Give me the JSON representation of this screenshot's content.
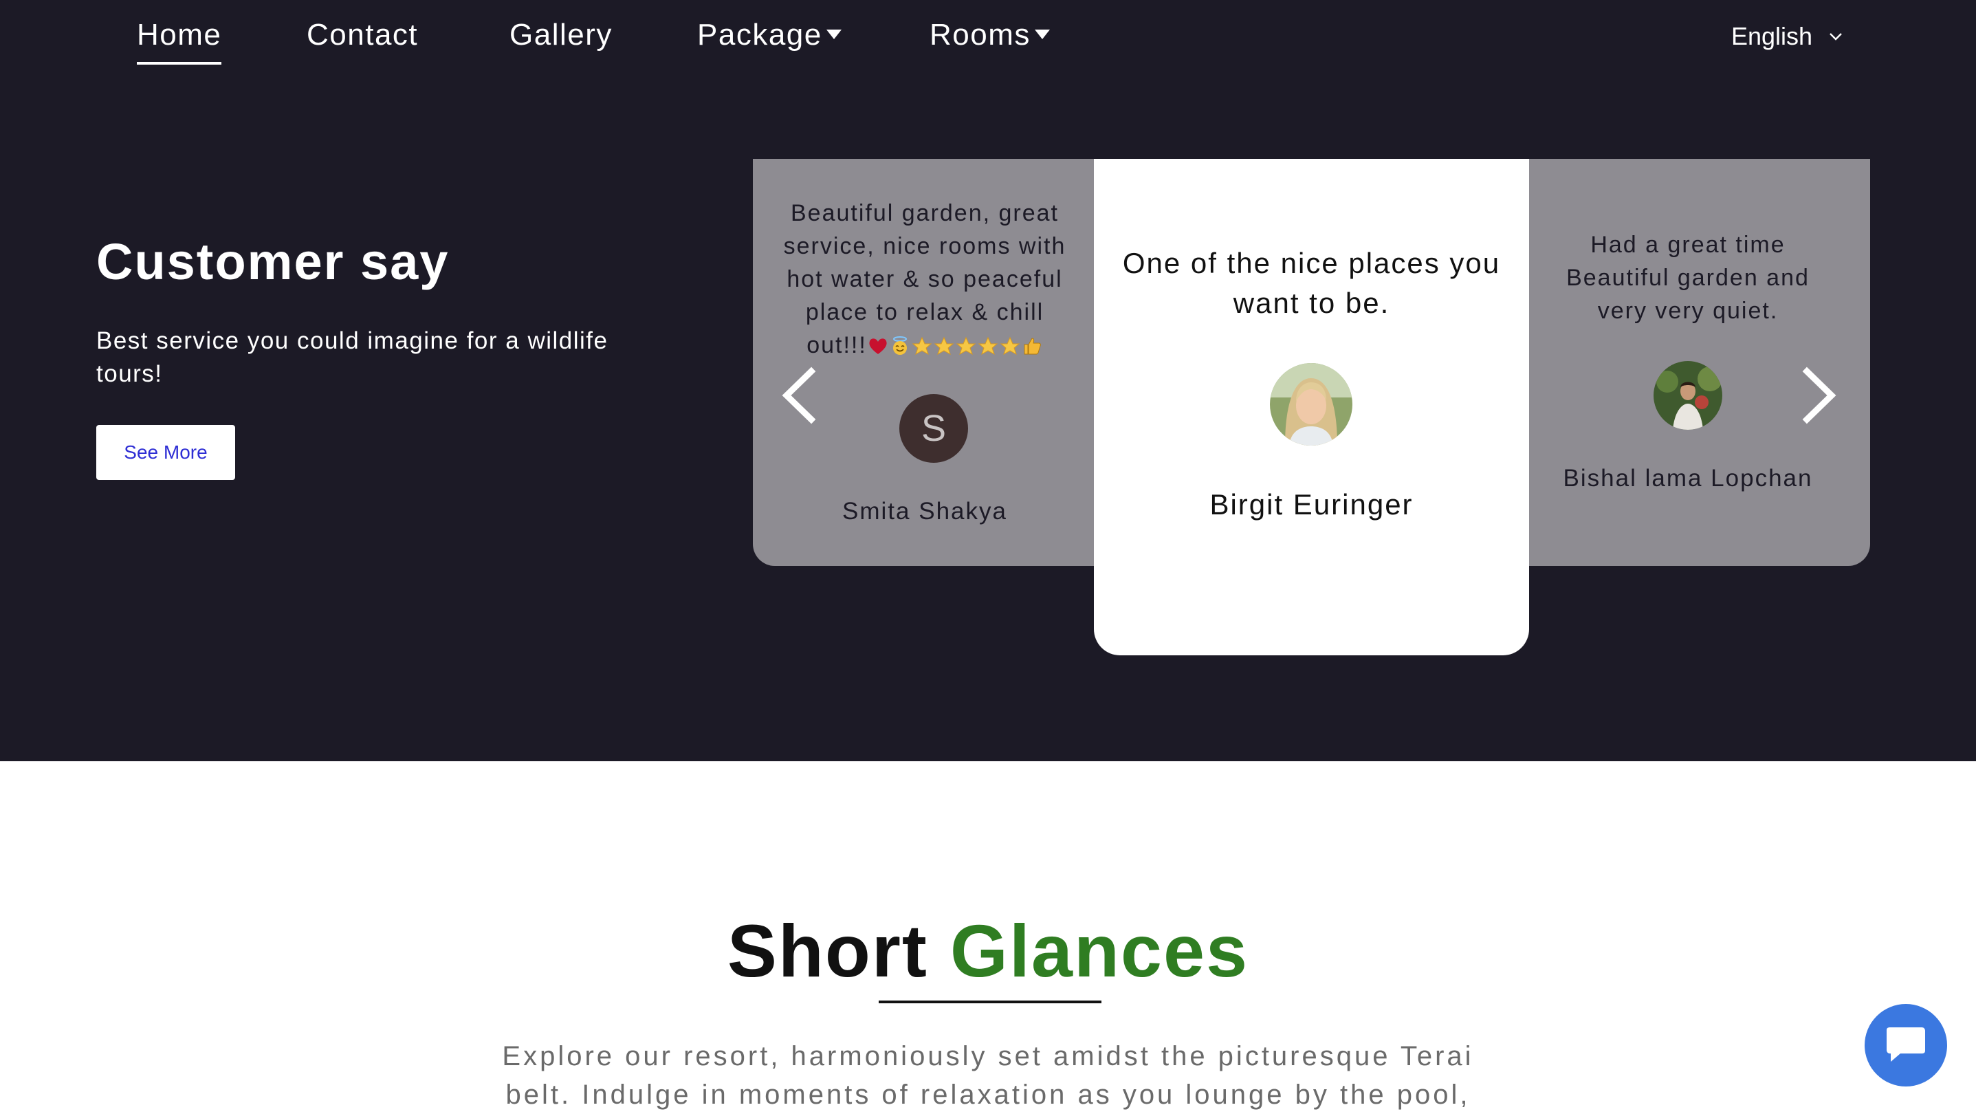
{
  "nav": {
    "items": [
      {
        "label": "Home",
        "active": true
      },
      {
        "label": "Contact"
      },
      {
        "label": "Gallery"
      },
      {
        "label": "Package",
        "dropdown": true
      },
      {
        "label": "Rooms",
        "dropdown": true
      }
    ],
    "language": "English"
  },
  "hero": {
    "title": "Customer say",
    "subtitle": "Best service you could imagine for a wildlife tours!",
    "button": "See More"
  },
  "testimonials": {
    "left": {
      "quote": "Beautiful garden, great service, nice rooms with hot water & so peaceful place to relax & chill out!!!",
      "emojis": [
        "heart-icon",
        "angel-face-icon",
        "star-icon",
        "star-icon",
        "star-icon",
        "star-icon",
        "star-icon",
        "thumbs-up-icon"
      ],
      "avatar_letter": "S",
      "name": "Smita Shakya"
    },
    "center": {
      "quote": "One of the nice places you want to be.",
      "name": "Birgit Euringer"
    },
    "right": {
      "quote": "Had a great time Beautiful garden and very very quiet.",
      "name": "Bishal lama Lopchan"
    }
  },
  "short_glances": {
    "title_main": "Short",
    "title_accent": "Glances",
    "text": "Explore our resort, harmoniously set amidst the picturesque Terai belt. Indulge in moments of relaxation as you lounge by the pool,"
  },
  "colors": {
    "dark_bg": "#1c1a26",
    "card_grey": "#8e8c92",
    "accent_green": "#2f7d22",
    "chat_blue": "#3b78e0"
  }
}
